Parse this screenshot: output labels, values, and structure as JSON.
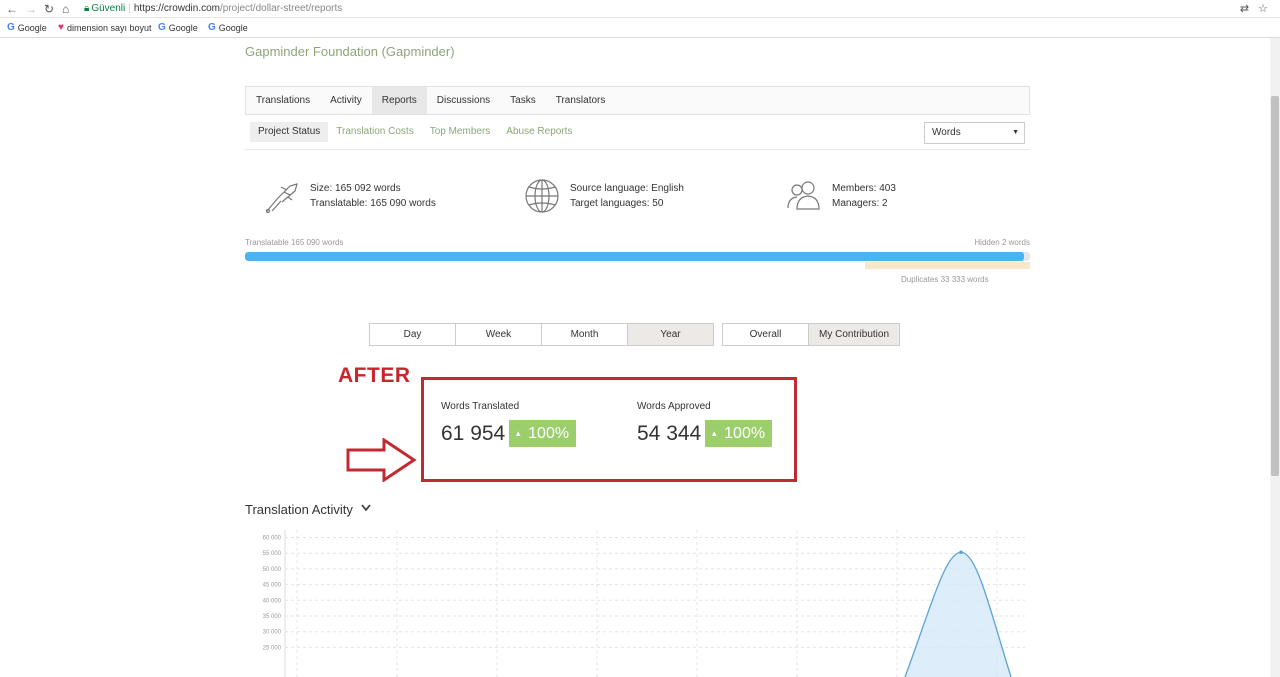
{
  "browser": {
    "secure_label": "Güvenli",
    "url_host": "https://crowdin.com",
    "url_path": "/project/dollar-street/reports",
    "bookmarks": [
      {
        "label": "Google",
        "icon": "google-icon"
      },
      {
        "label": "dimension sayı boyut",
        "icon": "heart-icon"
      },
      {
        "label": "Google",
        "icon": "google-icon"
      },
      {
        "label": "Google",
        "icon": "google-icon"
      }
    ]
  },
  "project": {
    "title": "Gapminder Foundation (Gapminder)"
  },
  "main_tabs": [
    "Translations",
    "Activity",
    "Reports",
    "Discussions",
    "Tasks",
    "Translators"
  ],
  "sub_tabs": [
    "Project Status",
    "Translation Costs",
    "Top Members",
    "Abuse Reports"
  ],
  "unit_select": {
    "value": "Words"
  },
  "stats": {
    "size": "Size: 165 092 words",
    "translatable": "Translatable: 165 090 words",
    "source": "Source language: English",
    "target": "Target languages: 50",
    "members": "Members: 403",
    "managers": "Managers: 2"
  },
  "progress": {
    "left_label": "Translatable 165 090 words",
    "right_label": "Hidden 2 words",
    "dup_label": "Duplicates 33 333 words",
    "fill_percent": 99.2
  },
  "period_buttons": [
    "Day",
    "Week",
    "Month",
    "Year"
  ],
  "scope_buttons": [
    "Overall",
    "My Contribution"
  ],
  "annotation": {
    "label": "AFTER"
  },
  "metrics": {
    "translated": {
      "label": "Words Translated",
      "value": "61 954",
      "change": "100%"
    },
    "approved": {
      "label": "Words Approved",
      "value": "54 344",
      "change": "100%"
    }
  },
  "activity": {
    "title": "Translation Activity"
  },
  "colors": {
    "accent_green": "#8ea57a",
    "badge_green": "#9ccf6c",
    "progress_blue": "#4db3f0",
    "annotation_red": "#c02a32"
  },
  "chart_data": {
    "type": "area",
    "y_ticks": [
      "60 000",
      "55 000",
      "50 000",
      "45 000",
      "40 000",
      "35 000",
      "30 000",
      "25 000"
    ],
    "ylim": [
      25000,
      60000
    ],
    "peak": {
      "value": 55300
    }
  }
}
